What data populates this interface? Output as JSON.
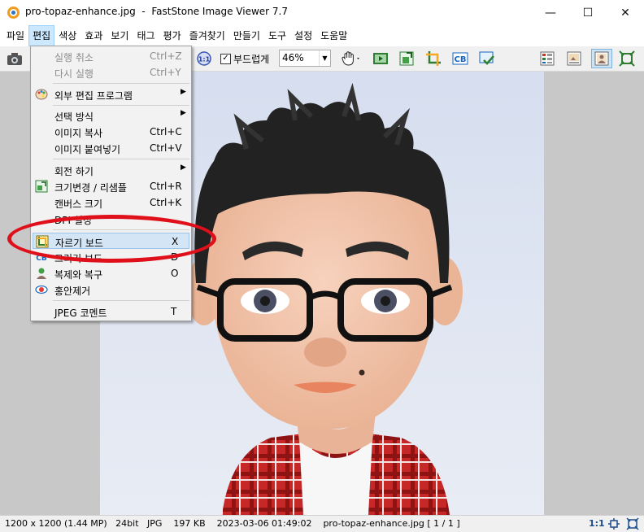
{
  "window": {
    "title": "pro-topaz-enhance.jpg  -  FastStone Image Viewer 7.7",
    "minimize_glyph": "—",
    "maximize_glyph": "☐",
    "close_glyph": "✕"
  },
  "menubar": [
    "파일",
    "편집",
    "색상",
    "효과",
    "보기",
    "태그",
    "평가",
    "즐겨찾기",
    "만들기",
    "도구",
    "설정",
    "도움말"
  ],
  "active_menu": "편집",
  "toolbar": {
    "smooth_label": "부드럽게",
    "smooth_checked": true,
    "zoom_value": "46%",
    "icons": [
      "camera-icon",
      "actual-size-icon",
      "hand-tool-icon",
      "slideshow-icon",
      "resize-icon",
      "crop-icon",
      "color-balance-icon",
      "batch-icon",
      "thumbnail-view-icon",
      "browser-view-icon",
      "full-view-icon",
      "fit-window-icon"
    ]
  },
  "edit_menu": {
    "items": [
      {
        "label": "실행 취소",
        "shortcut": "Ctrl+Z",
        "disabled": true
      },
      {
        "label": "다시 실행",
        "shortcut": "Ctrl+Y",
        "disabled": true
      },
      {
        "label": "외부 편집 프로그램",
        "submenu": true,
        "icon": "palette-icon"
      },
      {
        "label": "선택 방식",
        "submenu": true
      },
      {
        "label": "이미지 복사",
        "shortcut": "Ctrl+C"
      },
      {
        "label": "이미지 붙여넣기",
        "shortcut": "Ctrl+V"
      },
      {
        "label": "회전 하기",
        "submenu": true
      },
      {
        "label": "크기변경 / 리샘플",
        "shortcut": "Ctrl+R",
        "icon": "resize-icon"
      },
      {
        "label": "캔버스 크기",
        "shortcut": "Ctrl+K"
      },
      {
        "label": "DPI 설정"
      },
      {
        "label": "자르기 보드",
        "shortcut": "X",
        "icon": "crop-board-icon",
        "highlighted": true
      },
      {
        "label": "그리기 보드",
        "shortcut": "D",
        "icon": "draw-board-icon"
      },
      {
        "label": "복제와 복구",
        "shortcut": "O",
        "icon": "clone-heal-icon"
      },
      {
        "label": "홍안제거",
        "icon": "red-eye-icon"
      },
      {
        "label": "JPEG 코멘트",
        "shortcut": "T"
      }
    ]
  },
  "status": {
    "info": "1200 x 1200 (1.44 MP)   24bit   JPG    197 KB    2023-03-06 01:49:02    pro-topaz-enhance.jpg [ 1 / 1 ]",
    "ratio": "1:1"
  },
  "colors": {
    "highlight_oval": "#e0101b",
    "menu_highlight": "#d4e6f5",
    "photo_bg": "#dde3ef"
  }
}
